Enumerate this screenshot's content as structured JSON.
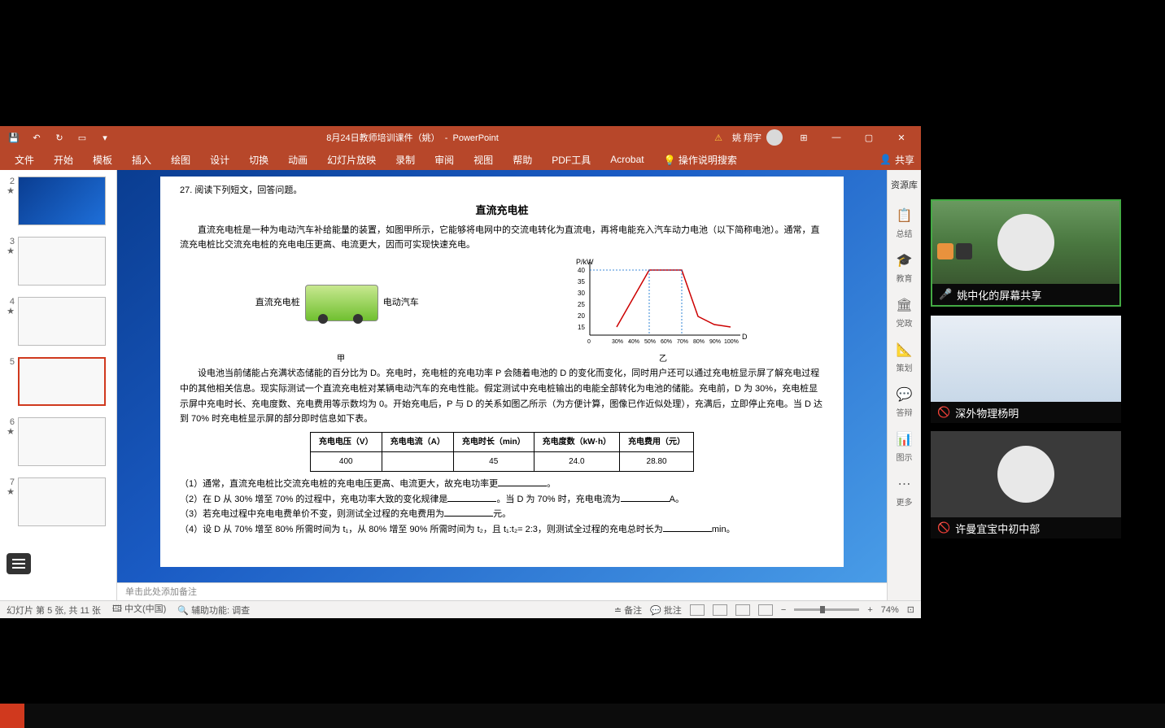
{
  "window": {
    "filename": "8月24日教师培训课件（姚）",
    "app": "PowerPoint",
    "user": "姚 翔宇"
  },
  "ribbon": {
    "tabs": [
      "文件",
      "开始",
      "模板",
      "插入",
      "绘图",
      "设计",
      "切换",
      "动画",
      "幻灯片放映",
      "录制",
      "审阅",
      "视图",
      "帮助",
      "PDF工具",
      "Acrobat"
    ],
    "tell_me": "操作说明搜索",
    "share": "共享"
  },
  "thumbnails": [
    {
      "num": "2",
      "kind": "blue"
    },
    {
      "num": "3",
      "kind": "white"
    },
    {
      "num": "4",
      "kind": "white"
    },
    {
      "num": "5",
      "kind": "white",
      "selected": true
    },
    {
      "num": "6",
      "kind": "white"
    },
    {
      "num": "7",
      "kind": "white"
    }
  ],
  "slide": {
    "q_num": "27. 阅读下列短文，回答问题。",
    "title": "直流充电桩",
    "p1": "直流充电桩是一种为电动汽车补给能量的装置，如图甲所示，它能够将电网中的交流电转化为直流电，再将电能充入汽车动力电池（以下简称电池）。通常，直流充电桩比交流充电桩的充电电压更高、电流更大，因而可实现快速充电。",
    "fig_left_label": "直流充电桩",
    "fig_right_label": "电动汽车",
    "fig_caption_left": "甲",
    "fig_caption_right": "乙",
    "chart_ylabel": "P/kW",
    "p2": "设电池当前储能占充满状态储能的百分比为 D。充电时，充电桩的充电功率 P 会随着电池的 D 的变化而变化，同时用户还可以通过充电桩显示屏了解充电过程中的其他相关信息。现实际测试一个直流充电桩对某辆电动汽车的充电性能。假定测试中充电桩输出的电能全部转化为电池的储能。充电前，D 为 30%，充电桩显示屏中充电时长、充电度数、充电费用等示数均为 0。开始充电后，P 与 D 的关系如图乙所示（为方便计算，图像已作近似处理），充满后，立即停止充电。当 D 达到 70% 时充电桩显示屏的部分即时信息如下表。",
    "table": {
      "headers": [
        "充电电压（V）",
        "充电电流（A）",
        "充电时长（min）",
        "充电度数（kW·h）",
        "充电费用（元）"
      ],
      "row": [
        "400",
        "",
        "45",
        "24.0",
        "28.80"
      ]
    },
    "q1": "（1）通常，直流充电桩比交流充电桩的充电电压更高、电流更大，故充电功率更",
    "q2a": "（2）在 D 从 30% 增至 70% 的过程中，充电功率大致的变化规律是",
    "q2b": "。当 D 为 70% 时，充电电流为",
    "q2c": "A。",
    "q3a": "（3）若充电过程中充电电费单价不变，则测试全过程的充电费用为",
    "q3b": "元。",
    "q4a": "（4）设 D 从 70% 增至 80% 所需时间为 t₁，从 80% 增至 90% 所需时间为 t₂，且 t₁:t₂= 2:3，则测试全过程的充电总时长为",
    "q4b": "min。"
  },
  "chart_data": {
    "type": "line",
    "xlabel": "D",
    "ylabel": "P/kW",
    "x_ticks": [
      0,
      30,
      40,
      50,
      60,
      70,
      80,
      90,
      100
    ],
    "y_ticks": [
      15,
      20,
      25,
      30,
      35,
      40
    ],
    "ylim": [
      0,
      45
    ],
    "series": [
      {
        "name": "P",
        "x": [
          30,
          50,
          70,
          80,
          90,
          100
        ],
        "y": [
          15,
          40,
          40,
          20,
          16,
          15
        ]
      }
    ]
  },
  "notes": "单击此处添加备注",
  "resource_panel": {
    "title": "资源库",
    "items": [
      "总结",
      "教育",
      "党政",
      "策划",
      "答辩",
      "图示",
      "更多"
    ]
  },
  "status": {
    "slide_pos": "幻灯片 第 5 张, 共 11 张",
    "lang": "中文(中国)",
    "access": "辅助功能: 调查",
    "notes_btn": "备注",
    "comments_btn": "批注",
    "zoom": "74%"
  },
  "participants": [
    {
      "name": "姚中化的屏幕共享",
      "muted": false
    },
    {
      "name": "深外物理杨明",
      "muted": true
    },
    {
      "name": "许曼宜宝中初中部",
      "muted": true
    }
  ]
}
